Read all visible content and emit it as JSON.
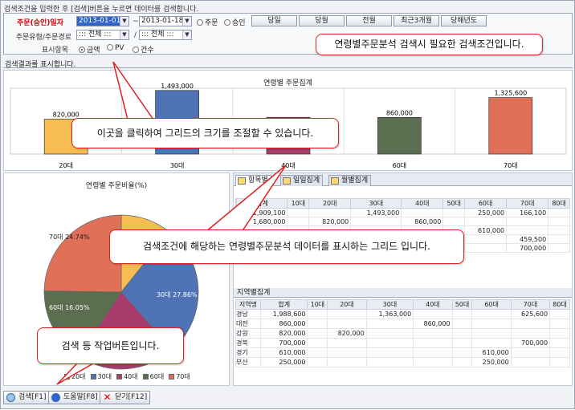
{
  "hint": "검색조건을 입력한 후 [검색]버튼을 누르면 데이터를 검색합니다.",
  "search": {
    "date_label": "주문(승인)일자",
    "date_from": "2013-01-01",
    "date_sep": "~",
    "date_to": "2013-01-18",
    "radio_order": "주문",
    "radio_approve": "승인",
    "btn_today": "당일",
    "btn_month": "당월",
    "btn_prev_month": "전월",
    "btn_3month": "최근3개월",
    "btn_year": "당해년도",
    "type_label": "주문유형/주문경로",
    "type_value": "::: 전체 :::",
    "slash": "/",
    "route_value": "::: 전체 :::",
    "display_label": "표시항목",
    "opt_amount": "금액",
    "opt_pv": "PV",
    "opt_count": "건수"
  },
  "results_label": "검색결과를 표시합니다.",
  "bar_chart": {
    "title": "연령별 주문집계"
  },
  "chart_data": [
    {
      "type": "bar",
      "title": "연령별 주문집계",
      "categories": [
        "20대",
        "30대",
        "40대",
        "60대",
        "70대"
      ],
      "values": [
        820000,
        1493000,
        863000,
        860000,
        1325600
      ],
      "labels": [
        "820,000",
        "1,493,000",
        "",
        "860,000",
        "1,325,600"
      ],
      "colors": [
        "#f7bd52",
        "#4f73b4",
        "#a83c6a",
        "#5b6e50",
        "#e07058"
      ],
      "ylim": [
        0,
        1500000
      ]
    },
    {
      "type": "pie",
      "title": "연령별 주문비율(%)",
      "categories": [
        "20대",
        "30대",
        "40대",
        "60대",
        "70대"
      ],
      "values": [
        10.71,
        27.86,
        20.64,
        16.05,
        24.74
      ],
      "colors": [
        "#f7bd52",
        "#4f73b4",
        "#a83c6a",
        "#5b6e50",
        "#e07058"
      ]
    }
  ],
  "pie_chart": {
    "title": "연령별 주문비율(%)",
    "label_30": "30대 27.86%",
    "label_60": "60대 16.05%",
    "label_70": "70대 24.74%",
    "legend": [
      "20대",
      "30대",
      "40대",
      "60대",
      "70대"
    ]
  },
  "tabs": [
    "항목별",
    "일일집계",
    "월별집계"
  ],
  "item_table": {
    "headers": [
      "",
      "합계",
      "10대",
      "20대",
      "30대",
      "40대",
      "50대",
      "60대",
      "70대",
      "80대"
    ],
    "rows": [
      [
        "",
        "1,909,100",
        "",
        "",
        "1,493,000",
        "",
        "",
        "250,000",
        "166,100",
        ""
      ],
      [
        "",
        "1,680,000",
        "",
        "820,000",
        "",
        "860,000",
        "",
        "",
        "",
        ""
      ],
      [
        "",
        "",
        "",
        "",
        "",
        "",
        "",
        "610,000",
        "",
        ""
      ],
      [
        "",
        "",
        "",
        "",
        "",
        "",
        "",
        "",
        "459,500",
        ""
      ],
      [
        "",
        "",
        "",
        "",
        "",
        "",
        "",
        "",
        "700,000",
        ""
      ]
    ]
  },
  "region_section": "지역별집계",
  "region_table": {
    "headers": [
      "지역명",
      "합계",
      "10대",
      "20대",
      "30대",
      "40대",
      "50대",
      "60대",
      "70대",
      "80대"
    ],
    "rows": [
      [
        "경남",
        "1,988,600",
        "",
        "",
        "1,363,000",
        "",
        "",
        "",
        "625,600",
        ""
      ],
      [
        "대전",
        "860,000",
        "",
        "",
        "",
        "860,000",
        "",
        "",
        "",
        ""
      ],
      [
        "강원",
        "820,000",
        "",
        "820,000",
        "",
        "",
        "",
        "",
        "",
        ""
      ],
      [
        "경북",
        "700,000",
        "",
        "",
        "",
        "",
        "",
        "",
        "700,000",
        ""
      ],
      [
        "경기",
        "610,000",
        "",
        "",
        "",
        "",
        "",
        "610,000",
        "",
        ""
      ],
      [
        "부산",
        "250,000",
        "",
        "",
        "",
        "",
        "",
        "250,000",
        "",
        ""
      ]
    ]
  },
  "bottom": {
    "search": "검색[F1]",
    "help": "도움말[F8]",
    "close": "닫기[F12]"
  },
  "callouts": {
    "search_cond": "연령별주문분석 검색시 필요한 검색조건입니다.",
    "resize": "이곳을 클릭하여 그리드의 크기를 조절할 수 있습니다.",
    "grid": "검색조건에 해당하는 연령별주문분석 데이터를 표시하는 그리드 입니다.",
    "buttons": "검색 등 작업버튼입니다."
  }
}
